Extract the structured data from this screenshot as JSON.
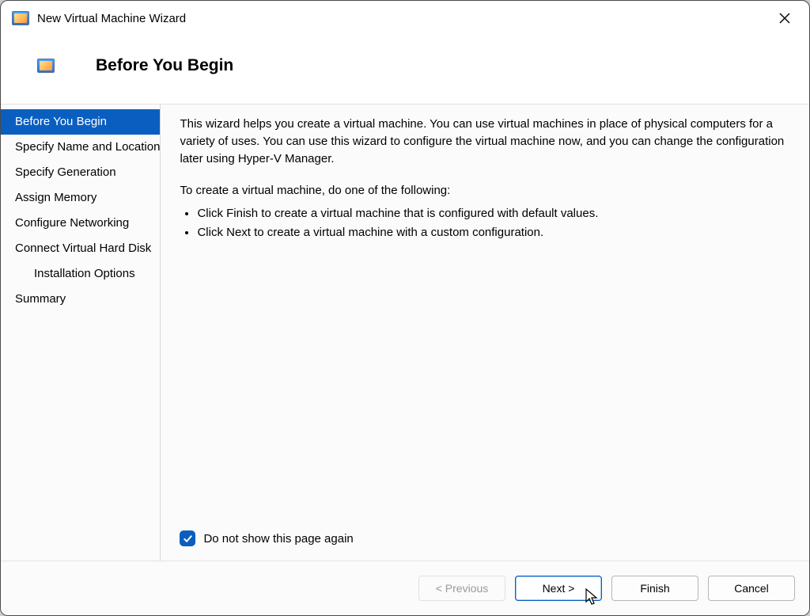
{
  "window": {
    "title": "New Virtual Machine Wizard",
    "page_title": "Before You Begin"
  },
  "sidebar": {
    "items": [
      {
        "label": "Before You Begin",
        "indent": false,
        "selected": true
      },
      {
        "label": "Specify Name and Location",
        "indent": false,
        "selected": false
      },
      {
        "label": "Specify Generation",
        "indent": false,
        "selected": false
      },
      {
        "label": "Assign Memory",
        "indent": false,
        "selected": false
      },
      {
        "label": "Configure Networking",
        "indent": false,
        "selected": false
      },
      {
        "label": "Connect Virtual Hard Disk",
        "indent": false,
        "selected": false
      },
      {
        "label": "Installation Options",
        "indent": true,
        "selected": false
      },
      {
        "label": "Summary",
        "indent": false,
        "selected": false
      }
    ]
  },
  "content": {
    "intro": "This wizard helps you create a virtual machine. You can use virtual machines in place of physical computers for a variety of uses. You can use this wizard to configure the virtual machine now, and you can change the configuration later using Hyper-V Manager.",
    "subhead": "To create a virtual machine, do one of the following:",
    "bullets": [
      "Click Finish to create a virtual machine that is configured with default values.",
      "Click Next to create a virtual machine with a custom configuration."
    ],
    "dont_show_label": "Do not show this page again",
    "dont_show_checked": true
  },
  "buttons": {
    "previous": "< Previous",
    "next": "Next >",
    "finish": "Finish",
    "cancel": "Cancel"
  }
}
